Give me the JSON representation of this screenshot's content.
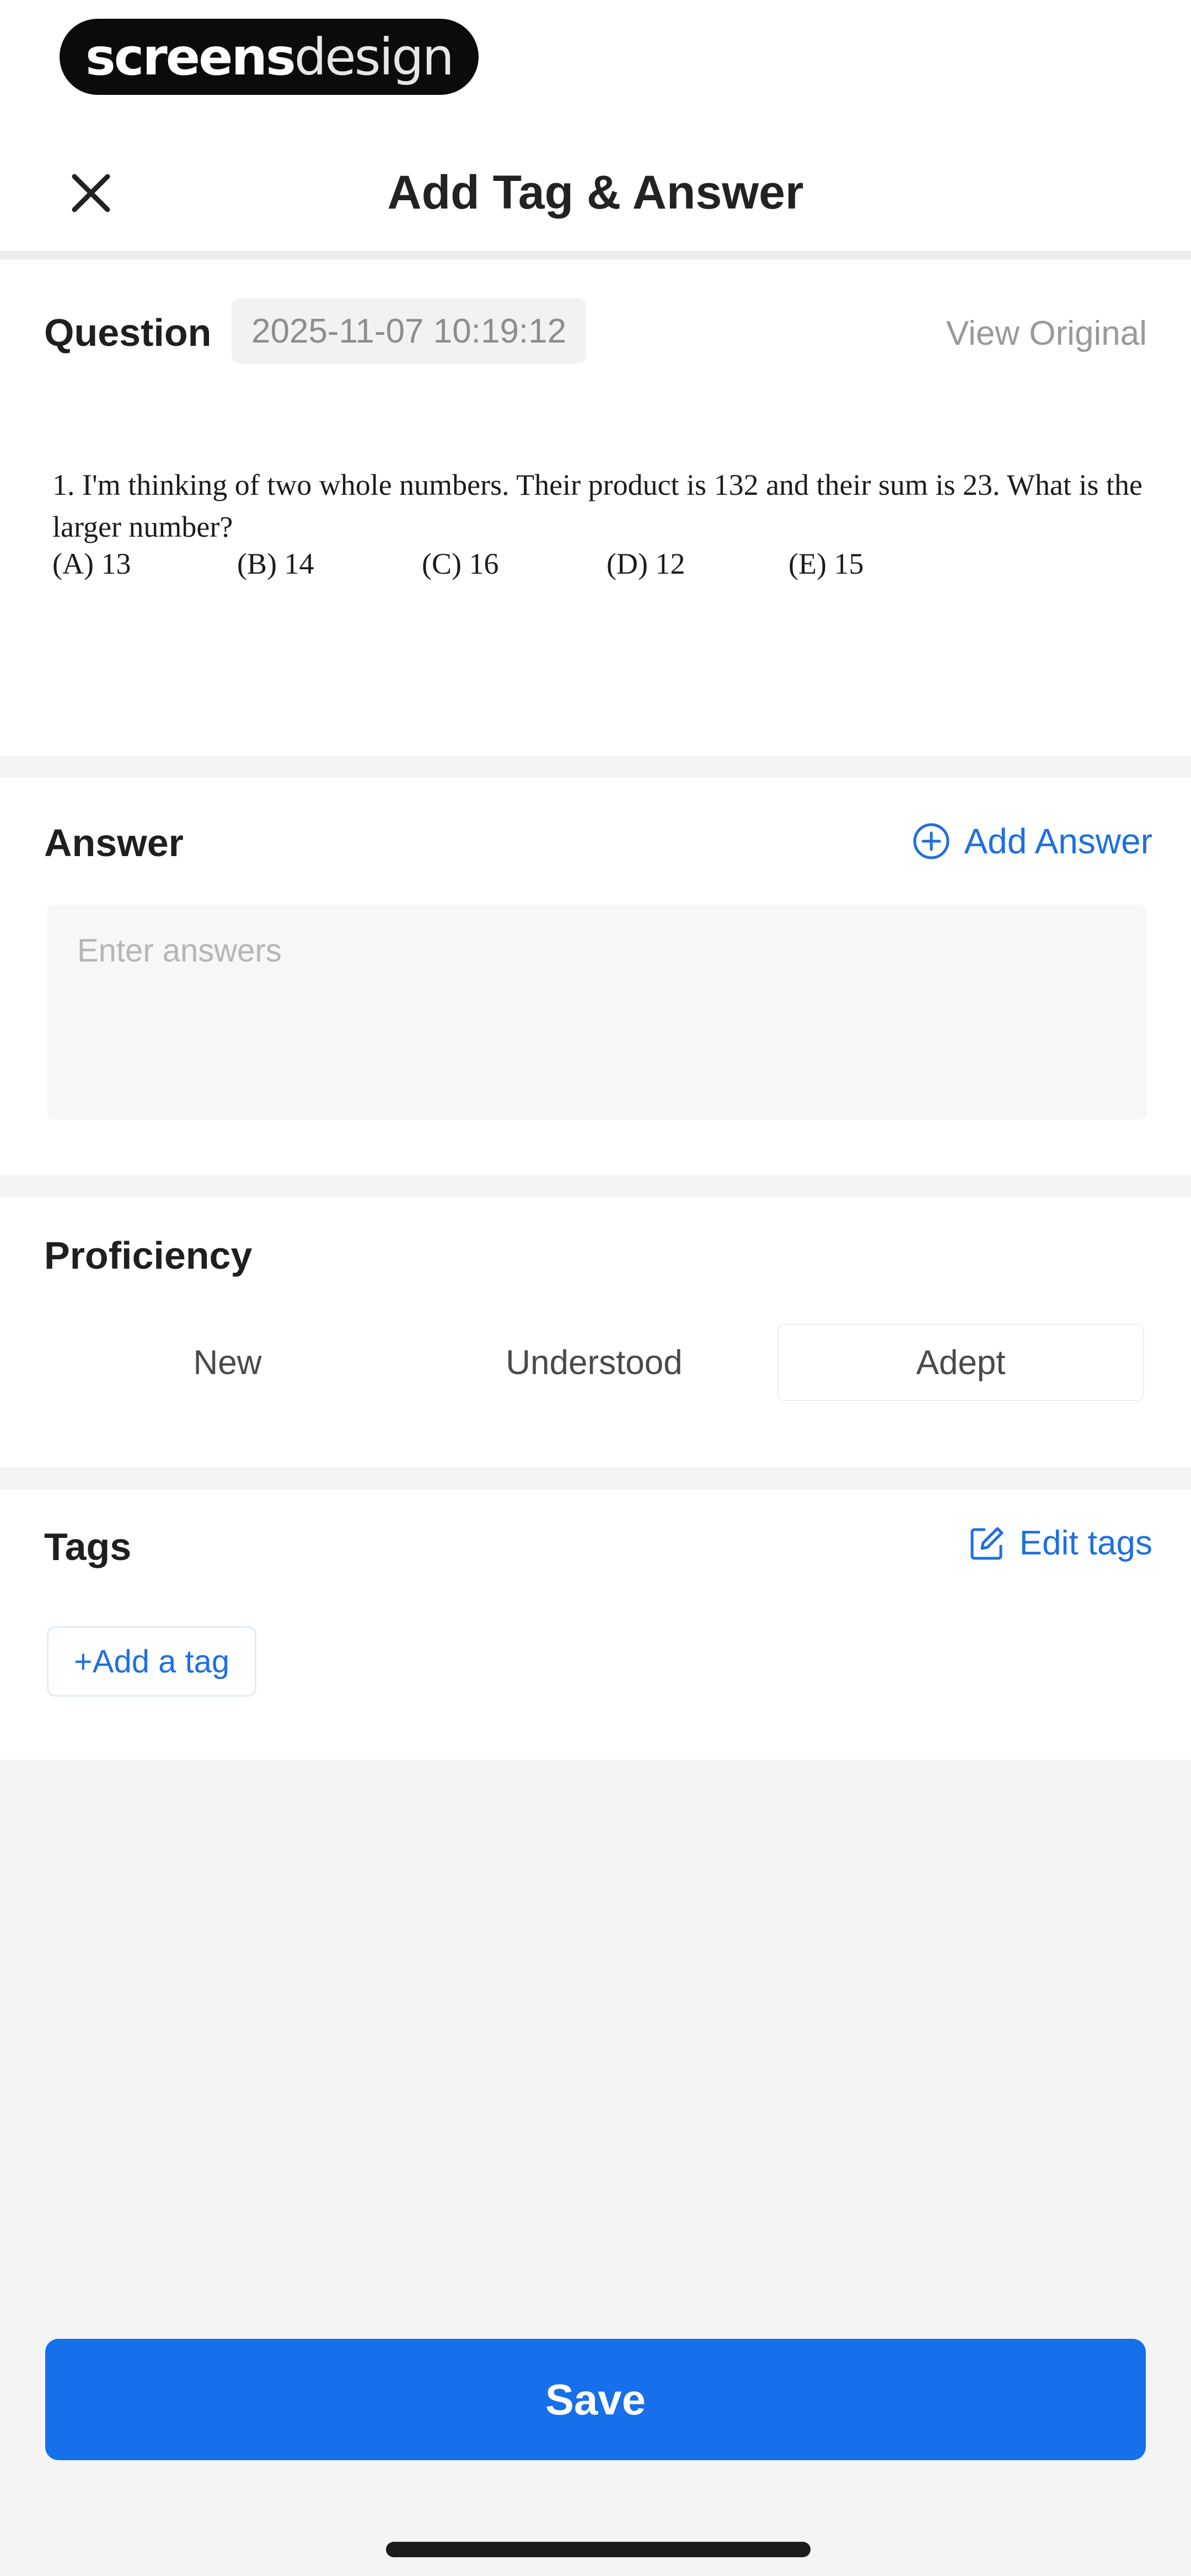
{
  "logo": {
    "part1": "screens",
    "part2": "design"
  },
  "header": {
    "title": "Add Tag & Answer",
    "close_icon": "close-icon"
  },
  "question": {
    "label": "Question",
    "timestamp": "2025-11-07 10:19:12",
    "view_original": "View Original",
    "text": "1. I'm thinking of two whole numbers. Their product is 132 and their sum is 23. What is the larger number?",
    "choices": [
      "(A) 13",
      "(B) 14",
      "(C) 16",
      "(D) 12",
      "(E) 15"
    ]
  },
  "answer": {
    "label": "Answer",
    "add_label": "Add Answer",
    "add_icon": "plus-circle-icon",
    "placeholder": "Enter answers"
  },
  "proficiency": {
    "label": "Proficiency",
    "options": [
      "New",
      "Understood",
      "Adept"
    ]
  },
  "tags": {
    "label": "Tags",
    "edit_label": "Edit tags",
    "edit_icon": "edit-icon",
    "add_tag_label": "+Add a tag"
  },
  "footer": {
    "save_label": "Save"
  },
  "colors": {
    "accent": "#1570ea",
    "link": "#1f6fe0",
    "background": "#f4f4f5"
  }
}
